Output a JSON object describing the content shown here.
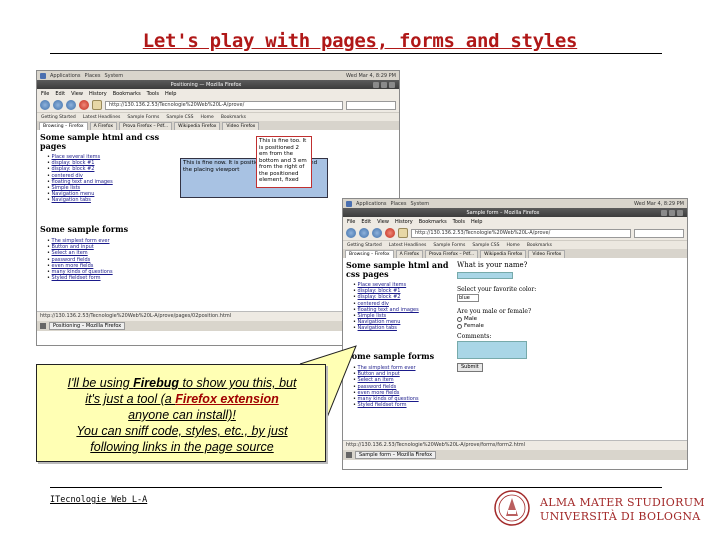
{
  "slide": {
    "title": "Let's play with pages, forms and styles",
    "footer": "ITecnologie Web L-A",
    "logo_line1": "ALMA MATER STUDIORUM",
    "logo_line2": "UNIVERSITÀ DI BOLOGNA"
  },
  "callout": {
    "line1_pre": "I'll be using ",
    "line1_link": "Firebug",
    "line1_post": " to show you this, but",
    "line2_pre": "it's just a tool (a ",
    "line2_link": "Firefox extension",
    "line3": "anyone can install)!",
    "line4": "You can sniff code, styles, etc., by just",
    "line5": "following links in the page source"
  },
  "browser1": {
    "os_menu": [
      "Applications",
      "Places",
      "System"
    ],
    "os_clock": "Wed Mar 4, 8:29 PM",
    "window_title": "Positioning — Mozilla Firefox",
    "menu": [
      "File",
      "Edit",
      "View",
      "History",
      "Bookmarks",
      "Tools",
      "Help"
    ],
    "url": "http://130.136.2.53/Tecnologie%20Web%20L-A/prove/",
    "bookmarks": [
      "Getting Started",
      "Latest Headlines",
      "Sample Forms",
      "Sample CSS",
      "Home",
      "Bookmarks"
    ],
    "tabs": [
      "Browsing – Firefox",
      "A Firefox",
      "Prova Firefox – Pdf...",
      "Wikipedia Firefox",
      "Video Firefox"
    ],
    "section1_title": "Some sample html and css pages",
    "section1_items": [
      "Place several items",
      "display: block #1",
      "display: block #2",
      "centered div",
      "floating text and images",
      "Simple lists",
      "Navigation menu",
      "Navigation tabs"
    ],
    "section2_title": "Some sample forms",
    "section2_items": [
      "The simplest form ever",
      "Button and input",
      "Select an item",
      "password fields",
      "even more fields",
      "many kinds of questions",
      "Styled fieldset form"
    ],
    "positioned_box": "This is fine now. It is positioned from the top and the placing viewport",
    "fixed_box": "This is fine too. It is positioned 2 em from the bottom and 3 em from the right of the positioned element, fixed",
    "status": "http://130.136.2.53/Tecnologie%20Web%20L-A/prove/pages/02position.html",
    "taskbar": "Positioning – Mozilla Firefox"
  },
  "browser2": {
    "os_menu": [
      "Applications",
      "Places",
      "System"
    ],
    "os_clock": "Wed Mar 4, 8:29 PM",
    "window_title": "Sample form – Mozilla Firefox",
    "menu": [
      "File",
      "Edit",
      "View",
      "History",
      "Bookmarks",
      "Tools",
      "Help"
    ],
    "url": "http://130.136.2.53/Tecnologie%20Web%20L-A/prove/",
    "bookmarks": [
      "Getting Started",
      "Latest Headlines",
      "Sample Forms",
      "Sample CSS",
      "Home",
      "Bookmarks"
    ],
    "tabs": [
      "Browsing – Firefox",
      "A Firefox",
      "Prova Firefox – Pdf...",
      "Wikipedia Firefox",
      "Video Firefox"
    ],
    "section1_title": "Some sample html and css pages",
    "section1_items": [
      "Place several items",
      "display: block #1",
      "display: block #2",
      "centered div",
      "floating text and images",
      "Simple lists",
      "Navigation menu",
      "Navigation tabs"
    ],
    "section2_title": "Some sample forms",
    "section2_items": [
      "The simplest form ever",
      "Button and input",
      "Select an item",
      "password fields",
      "even more fields",
      "many kinds of questions",
      "Styled fieldset form"
    ],
    "form_name_label": "What is your name?",
    "form_color_label": "Select your favorite color:",
    "form_color_value": "blue",
    "form_gender_label": "Are you male or female?",
    "form_male": "Male",
    "form_female": "Female",
    "form_comments_label": "Comments:",
    "form_submit": "Submit",
    "status": "http://130.136.2.53/Tecnologie%20Web%20L-A/prove/forms/form2.html",
    "taskbar": "Sample form – Mozilla Firefox"
  },
  "colors": {
    "title": "#b01818",
    "callout_bg": "#ffffb4",
    "highlight_red": "#a00000",
    "logo": "#a32a2a"
  }
}
